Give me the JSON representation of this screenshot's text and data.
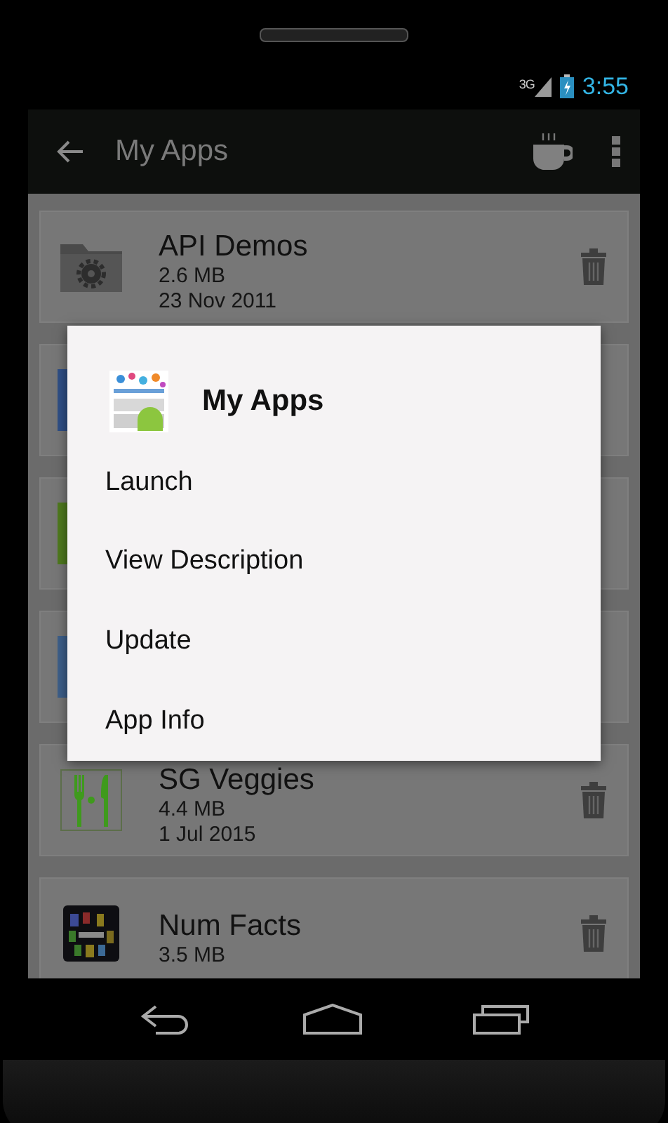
{
  "status_bar": {
    "network": "3G",
    "time": "3:55"
  },
  "action_bar": {
    "title": "My Apps"
  },
  "apps": [
    {
      "kind": "folder",
      "name": "API Demos",
      "size": "2.6 MB",
      "date": "23 Nov 2011"
    },
    {
      "kind": "covered",
      "color": "#2f4f86"
    },
    {
      "kind": "covered",
      "color": "#4f7a1e"
    },
    {
      "kind": "covered",
      "color": "#3d5f8a"
    },
    {
      "kind": "cutlery",
      "name": "SG Veggies",
      "size": "4.4 MB",
      "date": "1 Jul 2015"
    },
    {
      "kind": "tiles",
      "name": "Num Facts",
      "size": "3.5 MB"
    }
  ],
  "dialog": {
    "title": "My Apps",
    "items": [
      "Launch",
      "View Description",
      "Update",
      "App Info"
    ]
  }
}
